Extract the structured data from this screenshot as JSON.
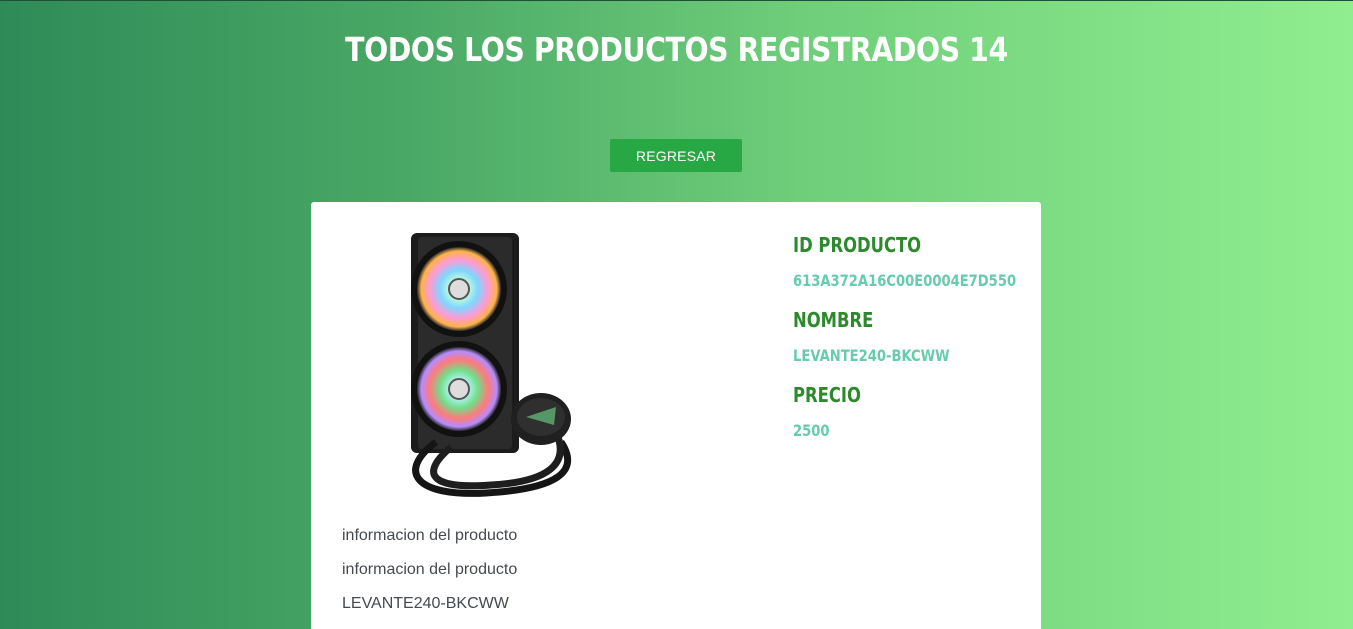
{
  "header": {
    "title": "TODOS LOS PRODUCTOS REGISTRADOS 14"
  },
  "actions": {
    "back_label": "REGRESAR"
  },
  "product": {
    "image_alt": "levante240-bkcww",
    "fields": [
      {
        "label": "ID PRODUCTO",
        "value": "613A372A16C00E0004E7D550"
      },
      {
        "label": "NOMBRE",
        "value": "LEVANTE240-BKCWW"
      },
      {
        "label": "PRECIO",
        "value": "2500"
      }
    ],
    "description_lines": [
      "informacion del producto",
      "informacion del producto",
      "LEVANTE240-BKCWW"
    ]
  },
  "colors": {
    "accent_button": "#28a745",
    "label_green": "#2b8a2b",
    "value_teal": "#66cdaa"
  }
}
